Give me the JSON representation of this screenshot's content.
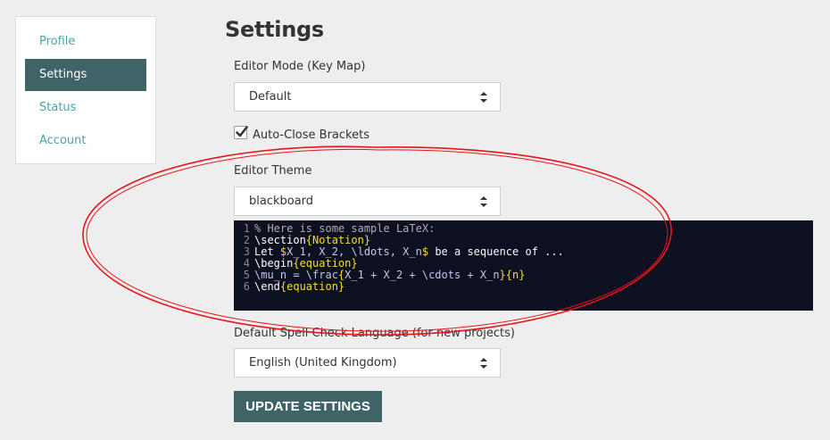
{
  "sidebar": {
    "items": [
      {
        "label": "Profile"
      },
      {
        "label": "Settings"
      },
      {
        "label": "Status"
      },
      {
        "label": "Account"
      }
    ]
  },
  "page": {
    "title": "Settings"
  },
  "editor_mode": {
    "label": "Editor Mode (Key Map)",
    "value": "Default"
  },
  "auto_close": {
    "label": "Auto-Close Brackets",
    "checked": true
  },
  "editor_theme": {
    "label": "Editor Theme",
    "value": "blackboard"
  },
  "code_sample": {
    "lines": [
      {
        "n": "1",
        "parts": [
          [
            "t-comment",
            "% Here is some sample LaTeX:"
          ]
        ]
      },
      {
        "n": "2",
        "parts": [
          [
            "t-kw",
            "\\section"
          ],
          [
            "t-arg",
            "{Notation}"
          ]
        ]
      },
      {
        "n": "3",
        "parts": [
          [
            "t-text",
            "Let "
          ],
          [
            "t-arg",
            "$"
          ],
          [
            "t-math",
            "X_1, X_2, \\ldots, X_n"
          ],
          [
            "t-arg",
            "$"
          ],
          [
            "t-text",
            " be a sequence of ..."
          ]
        ]
      },
      {
        "n": "4",
        "parts": [
          [
            "t-kw",
            "\\begin"
          ],
          [
            "t-arg",
            "{equation}"
          ]
        ]
      },
      {
        "n": "5",
        "parts": [
          [
            "t-math",
            "\\mu_n = \\frac"
          ],
          [
            "t-arg",
            "{"
          ],
          [
            "t-math",
            "X_1 + X_2 + \\cdots + X_n"
          ],
          [
            "t-arg",
            "}"
          ],
          [
            "t-arg",
            "{n}"
          ]
        ]
      },
      {
        "n": "6",
        "parts": [
          [
            "t-kw",
            "\\end"
          ],
          [
            "t-arg",
            "{equation}"
          ]
        ]
      }
    ]
  },
  "spell_check": {
    "label": "Default Spell Check Language (for new projects)",
    "value": "English (United Kingdom)"
  },
  "submit": {
    "label": "UPDATE SETTINGS"
  },
  "colors": {
    "accent": "#3e6467",
    "link": "#4aa3a6",
    "code_background": "#0c1021",
    "annotation": "#e8131b"
  }
}
